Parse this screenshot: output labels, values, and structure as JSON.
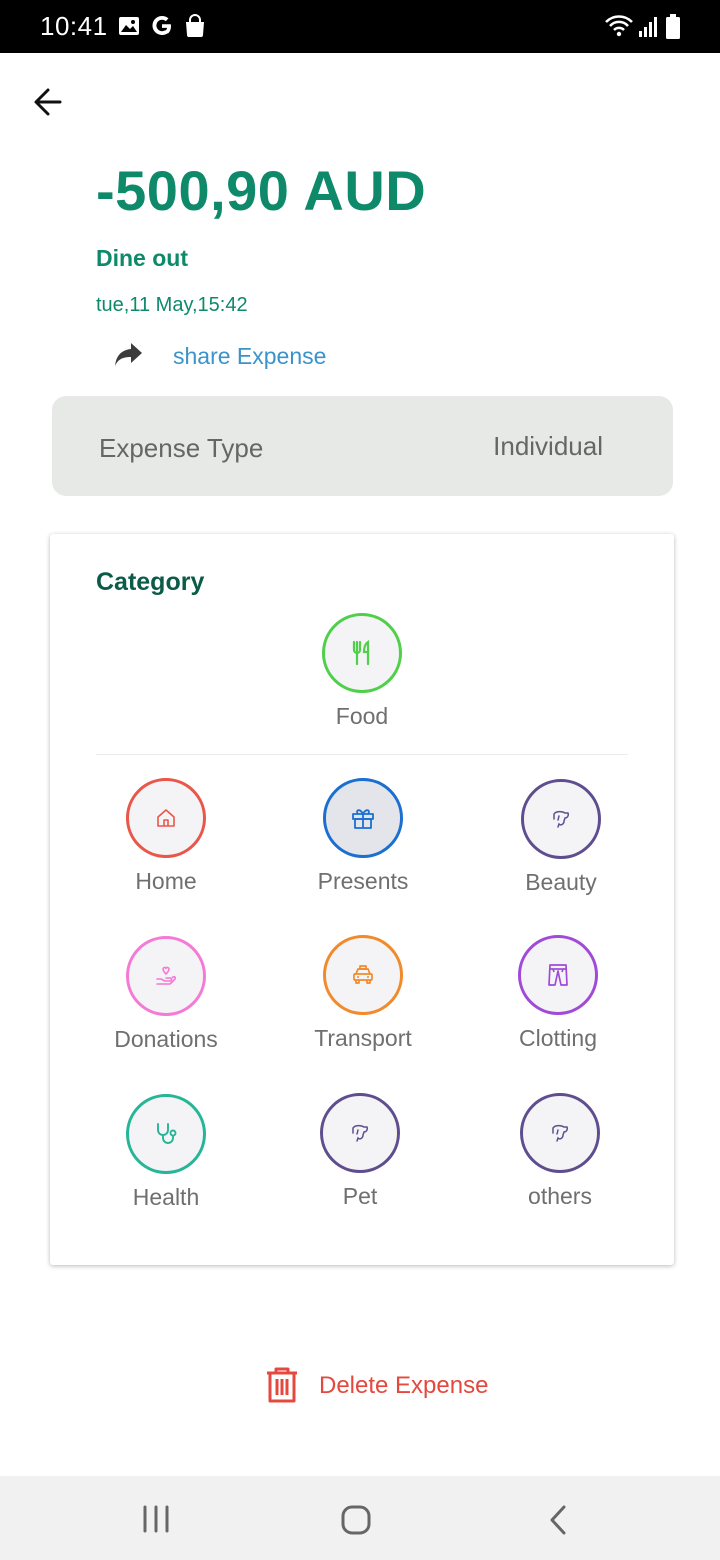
{
  "status_bar": {
    "time": "10:41",
    "icons": [
      "image-icon",
      "google-icon",
      "shopping-bag-icon",
      "wifi-icon",
      "signal-icon",
      "battery-icon"
    ]
  },
  "header": {
    "amount": "-500,90 AUD",
    "title": "Dine out",
    "datetime": "tue,11 May,15:42",
    "share_label": "share Expense",
    "accent_color": "#0e8a6b"
  },
  "expense_type": {
    "label": "Expense Type",
    "value": "Individual"
  },
  "category": {
    "title": "Category",
    "selected": {
      "label": "Food",
      "icon": "fork-knife-icon",
      "color": "#4fcf4a"
    },
    "items": [
      {
        "label": "Home",
        "icon": "home-icon",
        "color": "#e9564a"
      },
      {
        "label": "Presents",
        "icon": "gift-icon",
        "color": "#1a6fd1"
      },
      {
        "label": "Beauty",
        "icon": "dog-icon",
        "color": "#5f4e8f"
      },
      {
        "label": "Donations",
        "icon": "donation-hand-icon",
        "color": "#f47ad6"
      },
      {
        "label": "Transport",
        "icon": "taxi-icon",
        "color": "#f18a2b"
      },
      {
        "label": "Clotting",
        "icon": "pants-icon",
        "color": "#a04ad8"
      },
      {
        "label": "Health",
        "icon": "stethoscope-icon",
        "color": "#27b597"
      },
      {
        "label": "Pet",
        "icon": "dog-icon",
        "color": "#5f4e8f"
      },
      {
        "label": "others",
        "icon": "dog-icon",
        "color": "#5f4e8f"
      }
    ]
  },
  "actions": {
    "delete_label": "Delete Expense",
    "delete_color": "#e5483f"
  },
  "nav_bar": {
    "buttons": [
      "recent-apps-icon",
      "home-circle-icon",
      "back-chevron-icon"
    ]
  }
}
